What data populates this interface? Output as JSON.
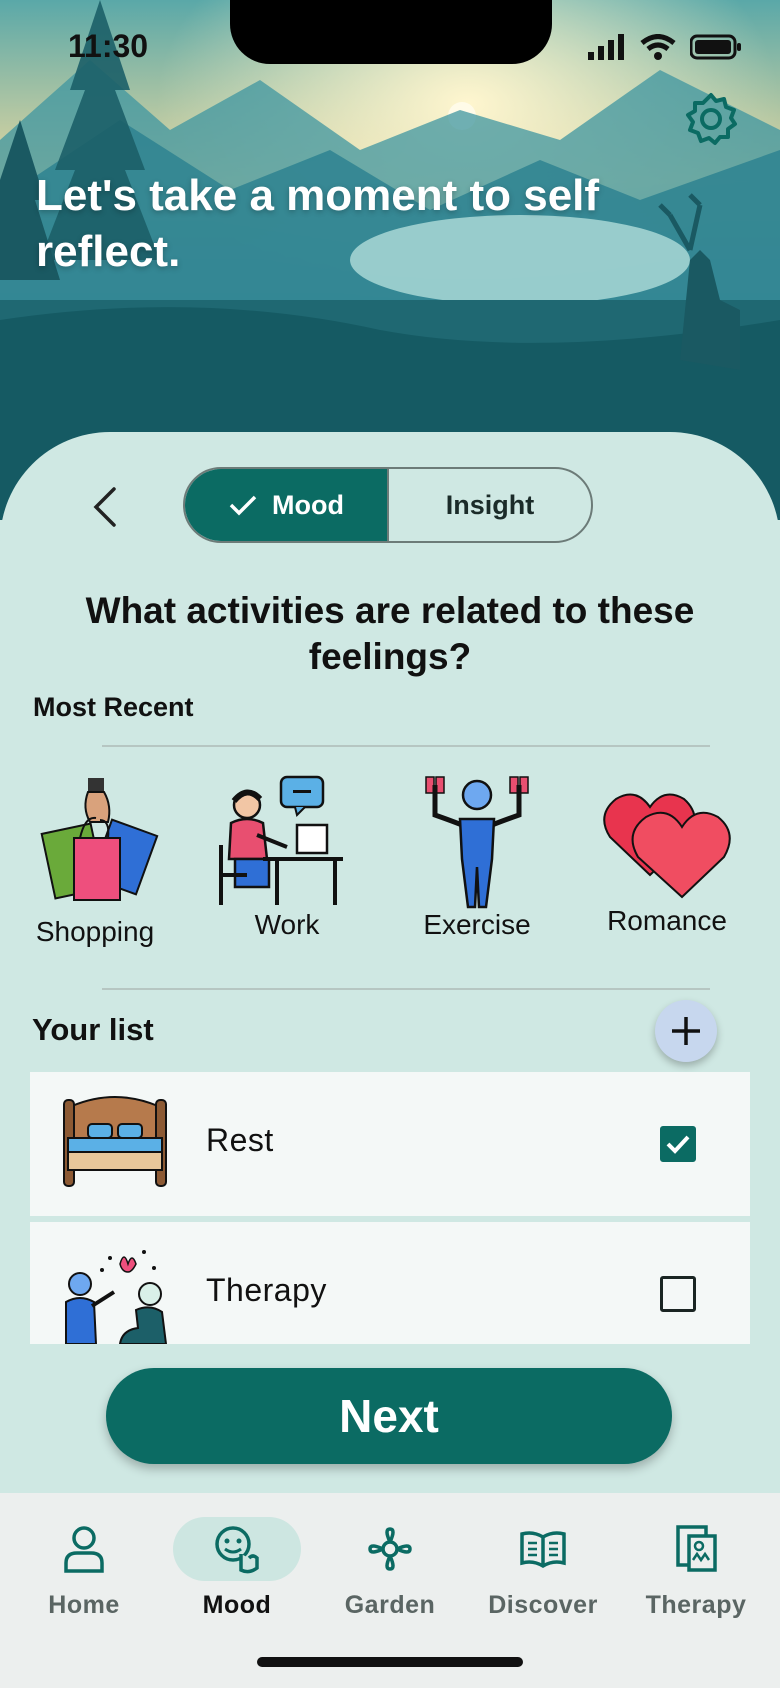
{
  "status": {
    "time": "11:30"
  },
  "hero": {
    "title": "Let's take a moment to self reflect."
  },
  "segment": {
    "active": "Mood",
    "inactive": "Insight"
  },
  "question": "What activities are related to these feelings?",
  "recent": {
    "label": "Most Recent",
    "items": [
      {
        "label": "Shopping",
        "icon": "shopping-bags-icon"
      },
      {
        "label": "Work",
        "icon": "work-desk-icon"
      },
      {
        "label": "Exercise",
        "icon": "exercise-icon"
      },
      {
        "label": "Romance",
        "icon": "hearts-icon"
      }
    ]
  },
  "your_list": {
    "label": "Your list",
    "items": [
      {
        "label": "Rest",
        "checked": true,
        "icon": "bed-icon"
      },
      {
        "label": "Therapy",
        "checked": false,
        "icon": "therapy-icon"
      }
    ]
  },
  "next_label": "Next",
  "nav": [
    {
      "label": "Home",
      "icon": "home-icon",
      "active": false
    },
    {
      "label": "Mood",
      "icon": "mood-icon",
      "active": true
    },
    {
      "label": "Garden",
      "icon": "flower-icon",
      "active": false
    },
    {
      "label": "Discover",
      "icon": "book-icon",
      "active": false
    },
    {
      "label": "Therapy",
      "icon": "therapy-doc-icon",
      "active": false
    }
  ],
  "colors": {
    "accent": "#0b6b63",
    "sheet": "#cfe8e3"
  }
}
